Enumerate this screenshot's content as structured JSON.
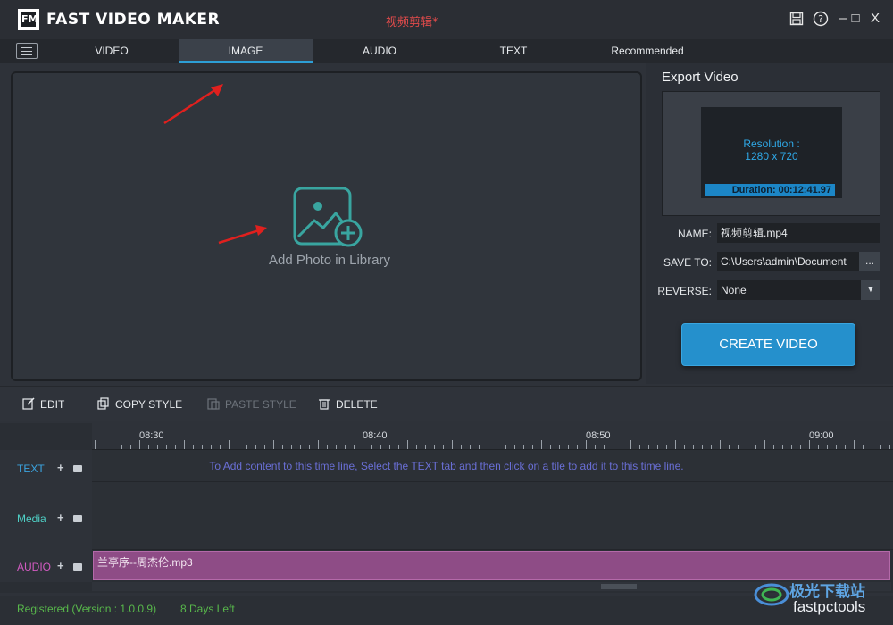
{
  "titlebar": {
    "logo_text": "FM",
    "app_name": "FAST VIDEO MAKER",
    "project_name": "视频剪辑*",
    "buttons": {
      "save": "save-icon",
      "help": "?",
      "minimize": "–",
      "maximize": "□",
      "close": "X"
    }
  },
  "tabs": [
    {
      "label": "VIDEO",
      "active": false
    },
    {
      "label": "IMAGE",
      "active": true
    },
    {
      "label": "AUDIO",
      "active": false
    },
    {
      "label": "TEXT",
      "active": false
    },
    {
      "label": "Recommended",
      "active": false
    }
  ],
  "preview": {
    "add_photo_label": "Add Photo in Library"
  },
  "export": {
    "title": "Export Video",
    "resolution_label": "Resolution :",
    "resolution_value": "1280 x 720",
    "duration": "Duration: 00:12:41.97",
    "name_label": "NAME:",
    "name_value": "视频剪辑.mp4",
    "save_to_label": "SAVE TO:",
    "save_to_value": "C:\\Users\\admin\\Document",
    "browse_label": "...",
    "reverse_label": "REVERSE:",
    "reverse_value": "None",
    "create_button": "CREATE VIDEO"
  },
  "toolbar": {
    "edit": "EDIT",
    "copy_style": "COPY STYLE",
    "paste_style": "PASTE STYLE",
    "delete": "DELETE"
  },
  "timeline": {
    "ruler_labels": [
      "08:30",
      "08:40",
      "08:50",
      "09:00"
    ],
    "tracks": [
      {
        "name": "TEXT",
        "color": "#3ba4e0"
      },
      {
        "name": "Media",
        "color": "#4fd1c7"
      },
      {
        "name": "AUDIO",
        "color": "#d35bc2"
      }
    ],
    "text_hint": "To Add content to this time line, Select the TEXT tab and then click on a tile to add it to this time line.",
    "audio_clip": "兰亭序--周杰伦.mp3"
  },
  "status": {
    "registered": "Registered (Version : 1.0.0.9)",
    "days_left": "8 Days Left"
  },
  "watermark": {
    "top": "极光下载站",
    "bottom": "fastpctools"
  }
}
